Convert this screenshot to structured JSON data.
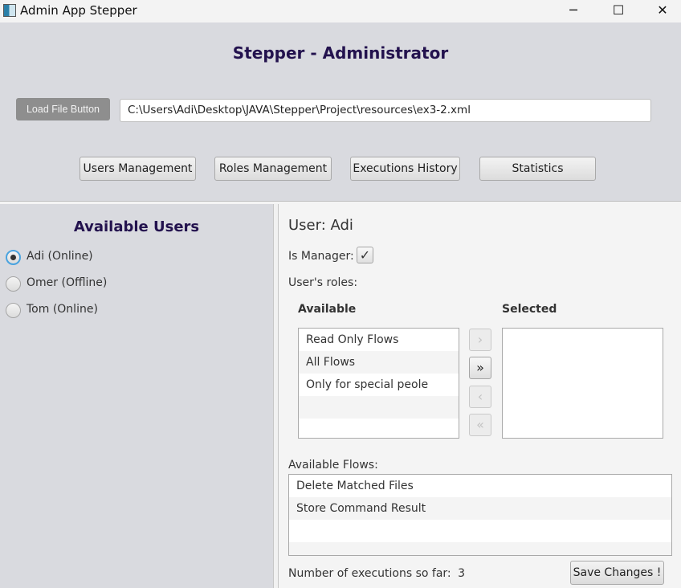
{
  "window": {
    "title": "Admin App Stepper",
    "minimize_glyph": "─",
    "maximize_glyph": "☐",
    "close_glyph": "✕"
  },
  "header": {
    "title": "Stepper - Administrator",
    "load_button_label": "Load File Button",
    "file_path": "C:\\Users\\Adi\\Desktop\\JAVA\\Stepper\\Project\\resources\\ex3-2.xml",
    "nav": {
      "users": "Users Management",
      "roles": "Roles Management",
      "executions": "Executions History",
      "statistics": "Statistics"
    }
  },
  "users_panel": {
    "title": "Available Users",
    "users": [
      {
        "label": "Adi (Online)",
        "selected": true
      },
      {
        "label": "Omer (Offline)",
        "selected": false
      },
      {
        "label": "Tom (Online)",
        "selected": false
      }
    ]
  },
  "details": {
    "user_title": "User: Adi",
    "is_manager_label": "Is Manager:",
    "is_manager_checked": true,
    "check_glyph": "✓",
    "roles_label": "User's roles:",
    "available_header": "Available",
    "selected_header": "Selected",
    "available_roles": [
      "Read Only Flows",
      "All Flows",
      "Only for special peole"
    ],
    "selected_roles": [],
    "arrows": {
      "move_right": "›",
      "move_all_right": "»",
      "move_left": "‹",
      "move_all_left": "«"
    },
    "flows_label": "Available Flows:",
    "flows": [
      "Delete Matched Files",
      "Store Command Result"
    ],
    "executions_label": "Number of executions so far:",
    "executions_count": "3",
    "save_button_label": "Save Changes !"
  },
  "colors": {
    "title_color": "#23124e",
    "panel_bg": "#d9dadf",
    "focus_ring": "#4aa3df"
  }
}
